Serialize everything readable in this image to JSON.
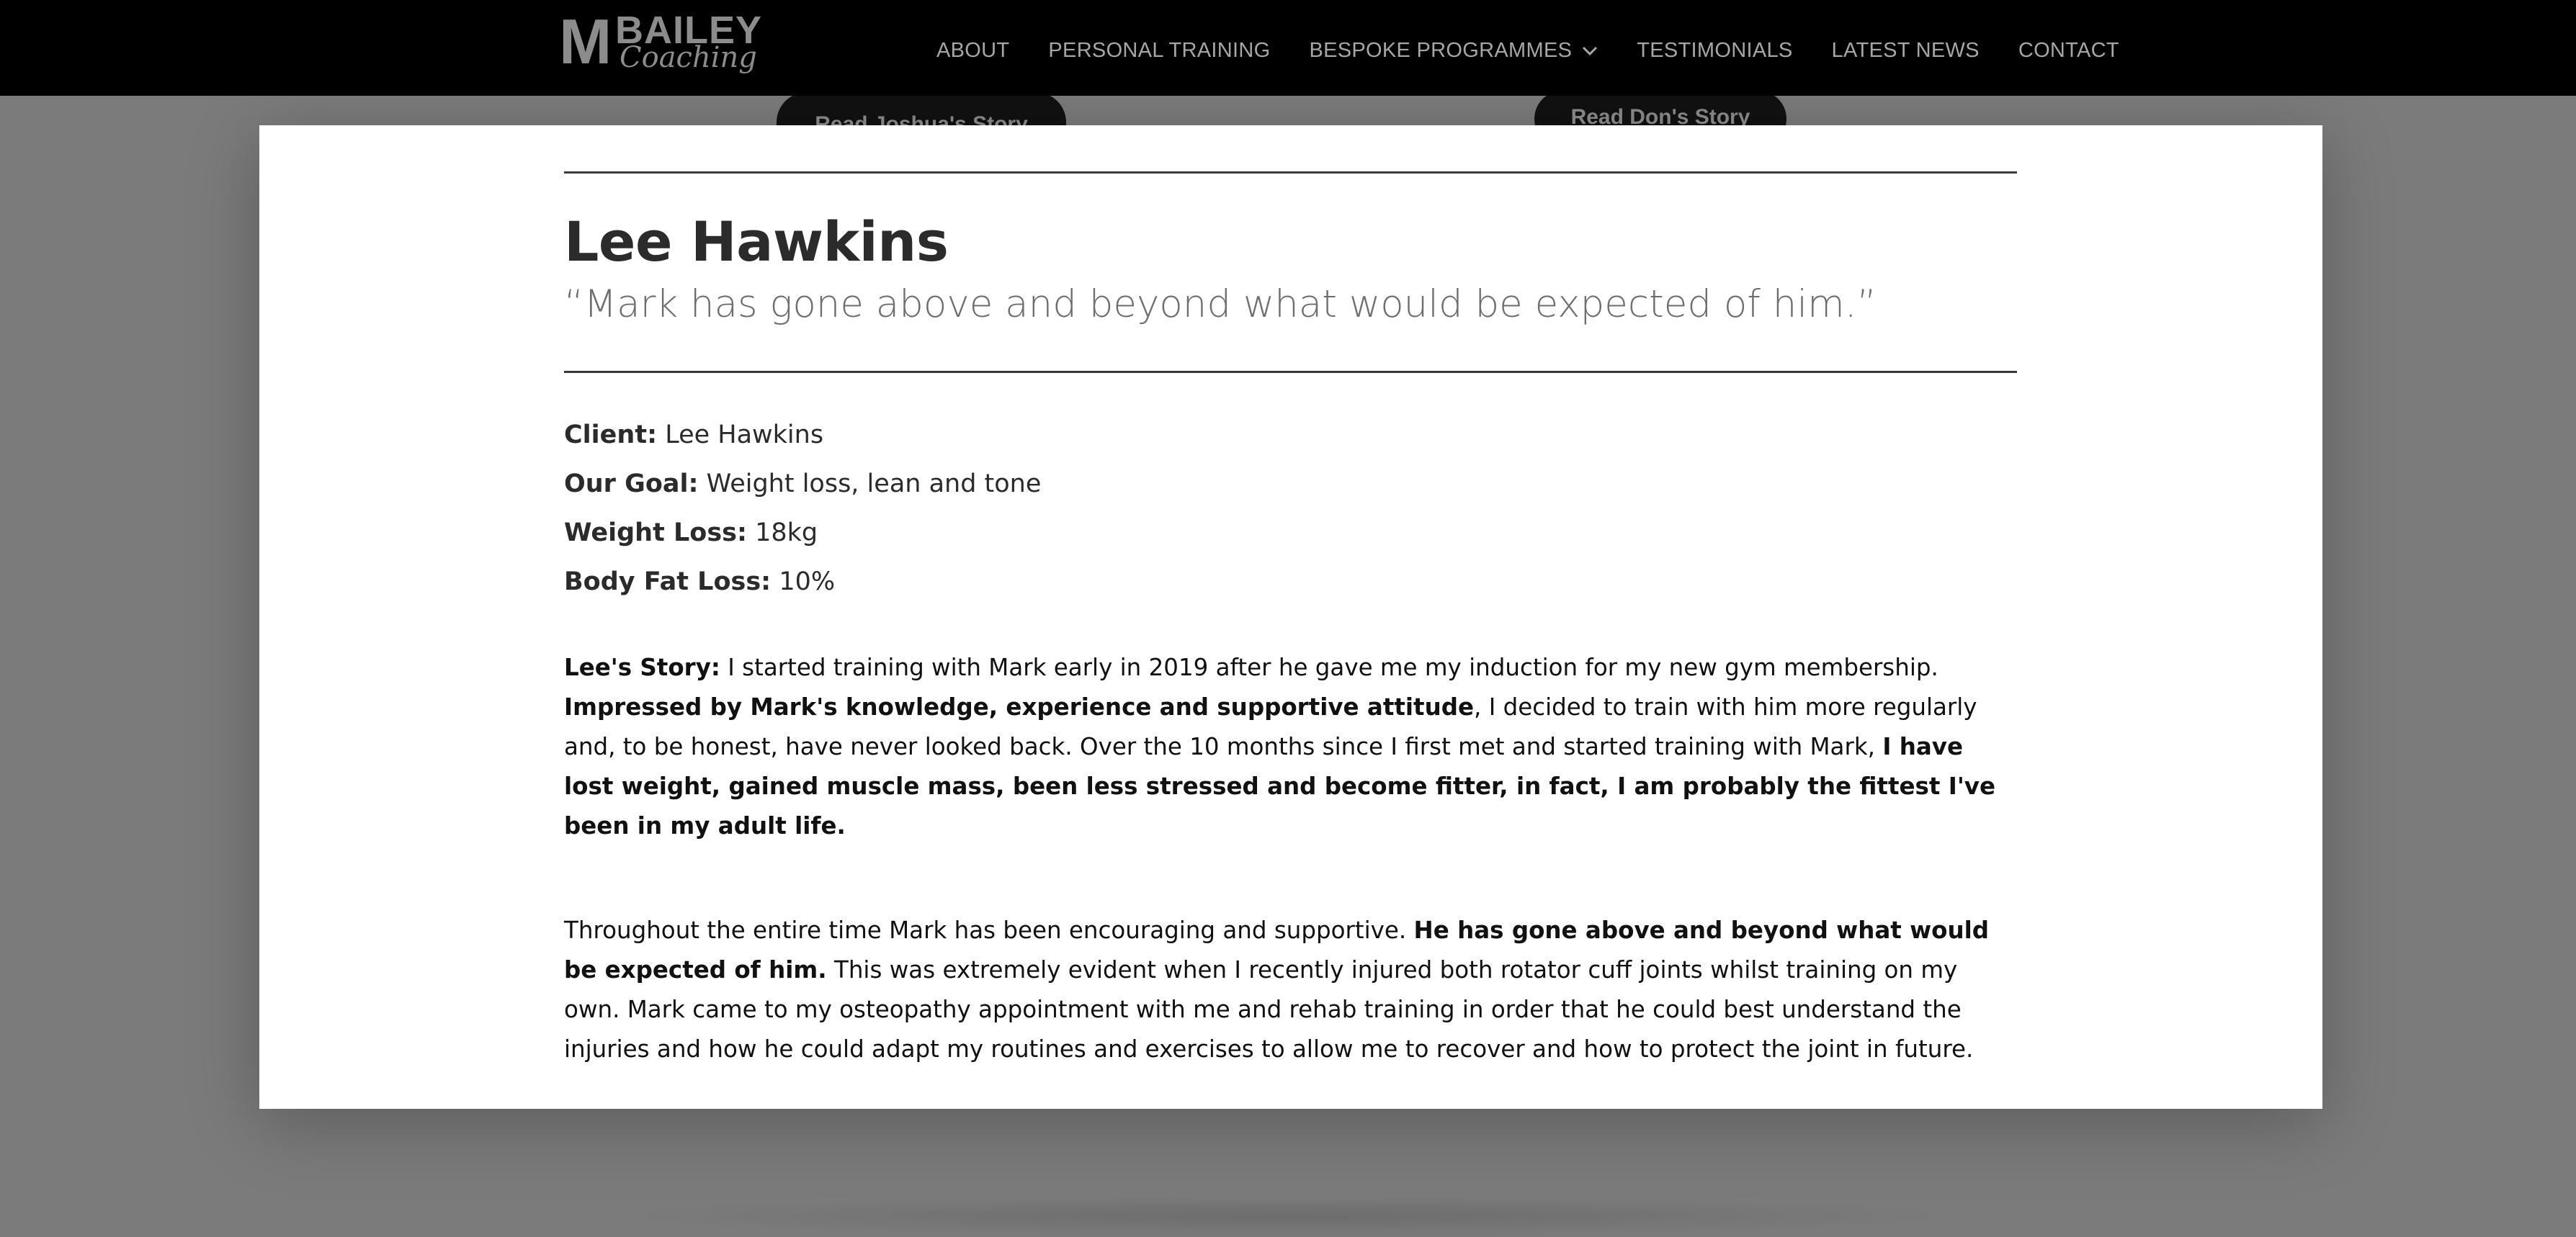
{
  "header": {
    "logo": {
      "m": "M",
      "bailey": "BAILEY",
      "coaching": "Coaching"
    },
    "nav": [
      {
        "label": "ABOUT"
      },
      {
        "label": "PERSONAL TRAINING"
      },
      {
        "label": "BESPOKE PROGRAMMES",
        "has_dropdown": true
      },
      {
        "label": "TESTIMONIALS"
      },
      {
        "label": "LATEST NEWS"
      },
      {
        "label": "CONTACT"
      }
    ]
  },
  "background_buttons": {
    "joshua": "Read Joshua's Story",
    "don": "Read Don's Story"
  },
  "modal": {
    "name": "Lee Hawkins",
    "quote": "“Mark has gone above and beyond what would be expected of him.”",
    "details": [
      {
        "label": "Client:",
        "value": " Lee Hawkins"
      },
      {
        "label": "Our Goal:",
        "value": " Weight loss, lean and tone"
      },
      {
        "label": "Weight Loss:",
        "value": " 18kg"
      },
      {
        "label": "Body Fat Loss:",
        "value": " 10%"
      }
    ],
    "story_p1": {
      "label": "Lee's Story:",
      "t1": " I started training with Mark early in 2019 after he gave me my induction for my new gym membership. ",
      "b1": "Impressed by Mark's knowledge, experience and supportive attitude",
      "t2": ", I decided to train with him more regularly and, to be honest, have never looked back. Over the 10 months since I first met and started training with Mark, ",
      "b2": "I have lost weight, gained muscle mass, been less stressed and become fitter, in fact, I am probably the fittest I've been in my adult life."
    },
    "story_p2": {
      "t1": "Throughout the entire time Mark has been encouraging and supportive. ",
      "b1": "He has gone above and beyond what would be expected of him.",
      "t2": " This was extremely evident when I recently injured both rotator cuff joints whilst training on my own. Mark came to my osteopathy appointment with me and rehab training in order that he could best understand the injuries and how he could adapt my routines and exercises to allow me to recover and how to protect the joint in future."
    }
  },
  "colors": {
    "header_bg": "#000000",
    "nav_text": "#a6a6a6",
    "overlay_bg": "#7b7b7b",
    "modal_bg": "#ffffff",
    "heading_text": "#2b2b2b",
    "quote_text": "#6e6e6e"
  }
}
